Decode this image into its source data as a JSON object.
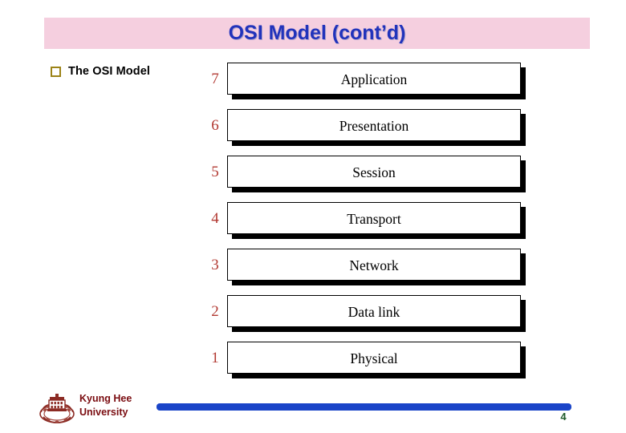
{
  "slide": {
    "title": "OSI Model (cont’d)",
    "title_band_color": "#f5cfdf",
    "title_text_color": "#2133bb",
    "background_color": "#ffffff"
  },
  "bullet": {
    "icon": "hollow-square-bullet",
    "bullet_color": "#9c8317",
    "text": "The OSI Model"
  },
  "osi_stack": {
    "number_color": "#b23a33",
    "box_border_color": "#000000",
    "box_fill_color": "#ffffff",
    "shadow_color": "#000000",
    "layers": [
      {
        "number": "7",
        "name": "Application"
      },
      {
        "number": "6",
        "name": "Presentation"
      },
      {
        "number": "5",
        "name": "Session"
      },
      {
        "number": "4",
        "name": "Transport"
      },
      {
        "number": "3",
        "name": "Network"
      },
      {
        "number": "2",
        "name": "Data link"
      },
      {
        "number": "1",
        "name": "Physical"
      }
    ]
  },
  "footer": {
    "logo_icon": "kyung-hee-university-crest",
    "logo_color": "#8c2b24",
    "org_line1": "Kyung Hee",
    "org_line2": "University",
    "org_text_color": "#7a0c10",
    "rule_color": "#1a44c8",
    "page_number": "4",
    "page_number_color": "#1f5b2a"
  }
}
